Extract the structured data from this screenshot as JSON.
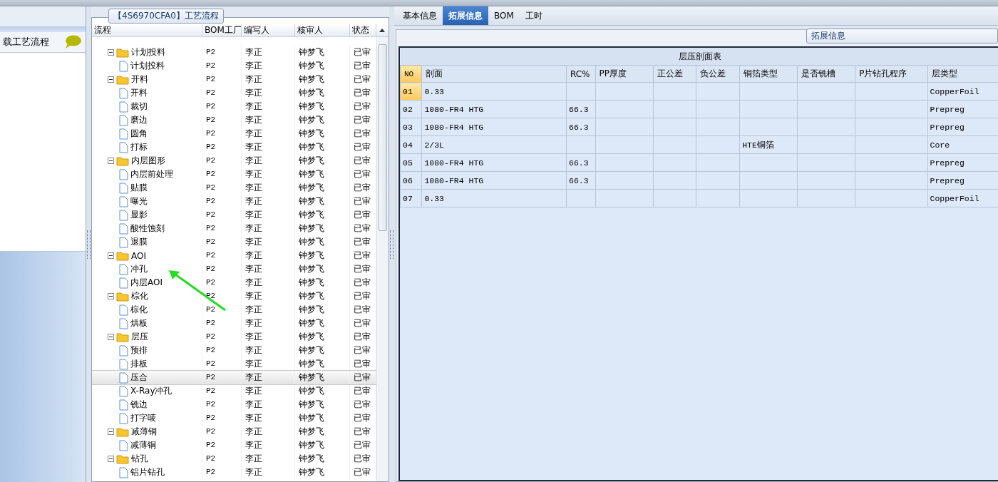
{
  "left_panel": {
    "title": "载工艺流程"
  },
  "flow": {
    "title": "【4S6970CFA0】工艺流程",
    "columns": [
      "流程",
      "BOM工厂",
      "编写人",
      "核审人",
      "状态"
    ],
    "nodes": [
      {
        "kind": "folder",
        "name": "计划投料",
        "bom": "P2",
        "writer": "李正",
        "reviewer": "钟梦飞",
        "status": "已审",
        "selected": false,
        "expanded": true,
        "children": [
          {
            "kind": "file",
            "name": "计划投料",
            "bom": "P2",
            "writer": "李正",
            "reviewer": "钟梦飞",
            "status": "已审",
            "selected": false
          }
        ]
      },
      {
        "kind": "folder",
        "name": "开料",
        "bom": "P2",
        "writer": "李正",
        "reviewer": "钟梦飞",
        "status": "已审",
        "selected": false,
        "expanded": true,
        "children": [
          {
            "kind": "file",
            "name": "开料",
            "bom": "P2",
            "writer": "李正",
            "reviewer": "钟梦飞",
            "status": "已审",
            "selected": false
          },
          {
            "kind": "file",
            "name": "裁切",
            "bom": "P2",
            "writer": "李正",
            "reviewer": "钟梦飞",
            "status": "已审",
            "selected": false
          },
          {
            "kind": "file",
            "name": "磨边",
            "bom": "P2",
            "writer": "李正",
            "reviewer": "钟梦飞",
            "status": "已审",
            "selected": false
          },
          {
            "kind": "file",
            "name": "圆角",
            "bom": "P2",
            "writer": "李正",
            "reviewer": "钟梦飞",
            "status": "已审",
            "selected": false
          },
          {
            "kind": "file",
            "name": "打标",
            "bom": "P2",
            "writer": "李正",
            "reviewer": "钟梦飞",
            "status": "已审",
            "selected": false
          }
        ]
      },
      {
        "kind": "folder",
        "name": "内层图形",
        "bom": "P2",
        "writer": "李正",
        "reviewer": "钟梦飞",
        "status": "已审",
        "selected": false,
        "expanded": true,
        "children": [
          {
            "kind": "file",
            "name": "内层前处理",
            "bom": "P2",
            "writer": "李正",
            "reviewer": "钟梦飞",
            "status": "已审",
            "selected": false
          },
          {
            "kind": "file",
            "name": "贴膜",
            "bom": "P2",
            "writer": "李正",
            "reviewer": "钟梦飞",
            "status": "已审",
            "selected": false
          },
          {
            "kind": "file",
            "name": "曝光",
            "bom": "P2",
            "writer": "李正",
            "reviewer": "钟梦飞",
            "status": "已审",
            "selected": false
          },
          {
            "kind": "file",
            "name": "显影",
            "bom": "P2",
            "writer": "李正",
            "reviewer": "钟梦飞",
            "status": "已审",
            "selected": false
          },
          {
            "kind": "file",
            "name": "酸性蚀刻",
            "bom": "P2",
            "writer": "李正",
            "reviewer": "钟梦飞",
            "status": "已审",
            "selected": false
          },
          {
            "kind": "file",
            "name": "退膜",
            "bom": "P2",
            "writer": "李正",
            "reviewer": "钟梦飞",
            "status": "已审",
            "selected": false
          }
        ]
      },
      {
        "kind": "folder",
        "name": "AOI",
        "bom": "P2",
        "writer": "李正",
        "reviewer": "钟梦飞",
        "status": "已审",
        "selected": false,
        "expanded": true,
        "children": [
          {
            "kind": "file",
            "name": "冲孔",
            "bom": "P2",
            "writer": "李正",
            "reviewer": "钟梦飞",
            "status": "已审",
            "selected": false
          },
          {
            "kind": "file",
            "name": "内层AOI",
            "bom": "P2",
            "writer": "李正",
            "reviewer": "钟梦飞",
            "status": "已审",
            "selected": false
          }
        ]
      },
      {
        "kind": "folder",
        "name": "棕化",
        "bom": "P2",
        "writer": "李正",
        "reviewer": "钟梦飞",
        "status": "已审",
        "selected": false,
        "expanded": true,
        "children": [
          {
            "kind": "file",
            "name": "棕化",
            "bom": "P2",
            "writer": "李正",
            "reviewer": "钟梦飞",
            "status": "已审",
            "selected": false
          },
          {
            "kind": "file",
            "name": "烘板",
            "bom": "P2",
            "writer": "李正",
            "reviewer": "钟梦飞",
            "status": "已审",
            "selected": false
          }
        ]
      },
      {
        "kind": "folder",
        "name": "层压",
        "bom": "P2",
        "writer": "李正",
        "reviewer": "钟梦飞",
        "status": "已审",
        "selected": false,
        "expanded": true,
        "children": [
          {
            "kind": "file",
            "name": "预排",
            "bom": "P2",
            "writer": "李正",
            "reviewer": "钟梦飞",
            "status": "已审",
            "selected": false
          },
          {
            "kind": "file",
            "name": "排板",
            "bom": "P2",
            "writer": "李正",
            "reviewer": "钟梦飞",
            "status": "已审",
            "selected": false
          },
          {
            "kind": "file",
            "name": "压合",
            "bom": "P2",
            "writer": "李正",
            "reviewer": "钟梦飞",
            "status": "已审",
            "selected": true
          },
          {
            "kind": "file",
            "name": "X-Ray冲孔",
            "bom": "P2",
            "writer": "李正",
            "reviewer": "钟梦飞",
            "status": "已审",
            "selected": false
          },
          {
            "kind": "file",
            "name": "铣边",
            "bom": "P2",
            "writer": "李正",
            "reviewer": "钟梦飞",
            "status": "已审",
            "selected": false
          },
          {
            "kind": "file",
            "name": "打字唛",
            "bom": "P2",
            "writer": "李正",
            "reviewer": "钟梦飞",
            "status": "已审",
            "selected": false
          }
        ]
      },
      {
        "kind": "folder",
        "name": "减薄铜",
        "bom": "P2",
        "writer": "李正",
        "reviewer": "钟梦飞",
        "status": "已审",
        "selected": false,
        "expanded": true,
        "children": [
          {
            "kind": "file",
            "name": "减薄铜",
            "bom": "P2",
            "writer": "李正",
            "reviewer": "钟梦飞",
            "status": "已审",
            "selected": false
          }
        ]
      },
      {
        "kind": "folder",
        "name": "钻孔",
        "bom": "P2",
        "writer": "李正",
        "reviewer": "钟梦飞",
        "status": "已审",
        "selected": false,
        "expanded": true,
        "children": [
          {
            "kind": "file",
            "name": "铝片钻孔",
            "bom": "P2",
            "writer": "李正",
            "reviewer": "钟梦飞",
            "status": "已审",
            "selected": false
          }
        ]
      }
    ]
  },
  "tabs": [
    {
      "label": "基本信息",
      "selected": false
    },
    {
      "label": "拓展信息",
      "selected": true
    },
    {
      "label": "BOM",
      "selected": false
    },
    {
      "label": "工时",
      "selected": false
    }
  ],
  "extended": {
    "title": "拓展信息",
    "table": {
      "title": "层压剖面表",
      "columns": [
        "NO",
        "剖面",
        "RC%",
        "PP厚度",
        "正公差",
        "负公差",
        "铜箔类型",
        "是否铣槽",
        "P片钻孔程序",
        "层类型"
      ],
      "rows": [
        {
          "selected": true,
          "cells": [
            "01",
            "0.33",
            "",
            "",
            "",
            "",
            "",
            "",
            "",
            "CopperFoil"
          ]
        },
        {
          "selected": false,
          "cells": [
            "02",
            "1080-FR4 HTG",
            "66.3",
            "",
            "",
            "",
            "",
            "",
            "",
            "Prepreg"
          ]
        },
        {
          "selected": false,
          "cells": [
            "03",
            "1080-FR4 HTG",
            "66.3",
            "",
            "",
            "",
            "",
            "",
            "",
            "Prepreg"
          ]
        },
        {
          "selected": false,
          "cells": [
            "04",
            "2/3L",
            "",
            "",
            "",
            "",
            "HTE铜箔",
            "",
            "",
            "Core"
          ]
        },
        {
          "selected": false,
          "cells": [
            "05",
            "1080-FR4 HTG",
            "66.3",
            "",
            "",
            "",
            "",
            "",
            "",
            "Prepreg"
          ]
        },
        {
          "selected": false,
          "cells": [
            "06",
            "1080-FR4 HTG",
            "66.3",
            "",
            "",
            "",
            "",
            "",
            "",
            "Prepreg"
          ]
        },
        {
          "selected": false,
          "cells": [
            "07",
            "0.33",
            "",
            "",
            "",
            "",
            "",
            "",
            "",
            "CopperFoil"
          ]
        }
      ]
    }
  }
}
